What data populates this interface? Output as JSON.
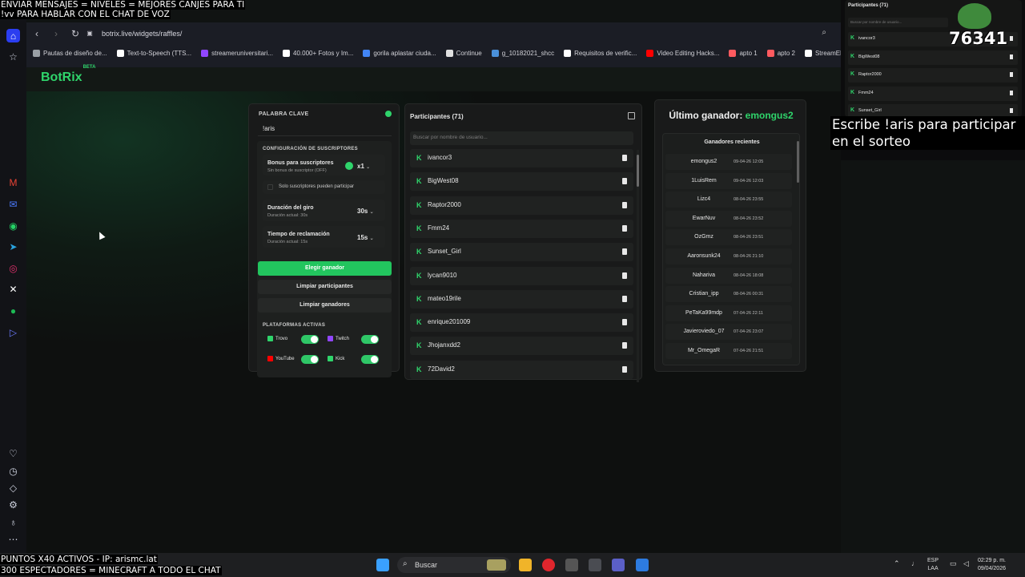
{
  "overlay": {
    "top_line1": "ENVIAR MENSAJES = NIVELES = MEJORES CANJES PARA TI",
    "top_line2": "!vv PARA HABLAR CON EL CHAT DE VOZ",
    "bottom_line1": "PUNTOS X40 ACTIVOS - IP: arismc.lat",
    "bottom_line2": "300 ESPECTADORES = MINECRAFT A TODO EL CHAT",
    "right_prompt_l1": "Escribe !aris para participar",
    "right_prompt_l2": "en el sorteo",
    "counter": "76341"
  },
  "browser": {
    "url": "botrix.live/widgets/raffles/",
    "bookmarks": [
      {
        "label": "Pautas de diseño de...",
        "color": "#9aa0a6"
      },
      {
        "label": "Text-to-Speech (TTS...",
        "color": "#ffffff"
      },
      {
        "label": "streameruniversitari...",
        "color": "#9146ff"
      },
      {
        "label": "40.000+ Fotos y Im...",
        "color": "#ffffff"
      },
      {
        "label": "gorila aplastar ciuda...",
        "color": "#4285f4"
      },
      {
        "label": "Continue",
        "color": "#e0e0e0"
      },
      {
        "label": "g_10182021_shcc",
        "color": "#4a90d9"
      },
      {
        "label": "Requisitos de verific...",
        "color": "#ffffff"
      },
      {
        "label": "Video Editing Hacks...",
        "color": "#ff0000"
      },
      {
        "label": "apto 1",
        "color": "#ff5a5f"
      },
      {
        "label": "apto 2",
        "color": "#ff5a5f"
      },
      {
        "label": "StreamElements",
        "color": "#ffffff"
      }
    ]
  },
  "logo": {
    "text": "BotRix",
    "badge": "BETA"
  },
  "config": {
    "keyword_label": "PALABRA CLAVE",
    "keyword": "!aris",
    "subs_title": "CONFIGURACIÓN DE SUSCRIPTORES",
    "bonus_title": "Bonus para suscriptores",
    "bonus_desc": "Sin bonus de suscriptor (OFF)",
    "bonus_value": "x1",
    "only_subs": "Solo suscriptores pueden participar",
    "spin_title": "Duración del giro",
    "spin_desc": "Duración actual: 30s",
    "spin_value": "30s",
    "claim_title": "Tiempo de reclamación",
    "claim_desc": "Duración actual: 15s",
    "claim_value": "15s",
    "btn_pick": "Elegir ganador",
    "btn_clear_participants": "Limpiar participantes",
    "btn_clear_winners": "Limpiar ganadores",
    "platforms_title": "PLATAFORMAS ACTIVAS",
    "platforms": [
      {
        "name": "Trovo",
        "color": "#2fd46b"
      },
      {
        "name": "Twitch",
        "color": "#9146ff"
      },
      {
        "name": "YouTube",
        "color": "#ff0000"
      },
      {
        "name": "Kick",
        "color": "#2fd46b"
      }
    ]
  },
  "participants": {
    "title": "Participantes (71)",
    "search_placeholder": "Buscar por nombre de usuario...",
    "items": [
      "ivancor3",
      "BigWest08",
      "Raptor2000",
      "Fmm24",
      "Sunset_Girl",
      "lycan9010",
      "mateo19rile",
      "enrique201009",
      "Jhojanxdd2",
      "72David2"
    ]
  },
  "winners": {
    "title_prefix": "Último ganador:",
    "last_winner": "emongus2",
    "recent_title": "Ganadores recientes",
    "items": [
      {
        "name": "emongus2",
        "date": "09-04-26 12:05"
      },
      {
        "name": "1LuisRem",
        "date": "09-04-26 12:03"
      },
      {
        "name": "Lizc4",
        "date": "08-04-26 23:55"
      },
      {
        "name": "EwarNuv",
        "date": "08-04-26 23:52"
      },
      {
        "name": "OzGmz",
        "date": "08-04-26 23:51"
      },
      {
        "name": "Aaronsunk24",
        "date": "08-04-26 21:10"
      },
      {
        "name": "Nahariva",
        "date": "08-04-26 18:08"
      },
      {
        "name": "Cristian_ipp",
        "date": "08-04-26 00:31"
      },
      {
        "name": "PeTaKa99mdp",
        "date": "07-04-26 22:11"
      },
      {
        "name": "Javieroviedo_07",
        "date": "07-04-26 23:07"
      },
      {
        "name": "Mr_OmegaR",
        "date": "07-04-26 21:51"
      }
    ]
  },
  "mini": {
    "title": "Participantes (71)",
    "search_placeholder": "Buscar por nombre de usuario...",
    "items": [
      "ivancor3",
      "BigWest08",
      "Raptor2000",
      "Fmm24",
      "Sunset_Girl"
    ]
  },
  "taskbar": {
    "search": "Buscar",
    "lang1": "ESP",
    "lang2": "LAA",
    "time": "02:29 p. m.",
    "date": "09/04/2026"
  }
}
